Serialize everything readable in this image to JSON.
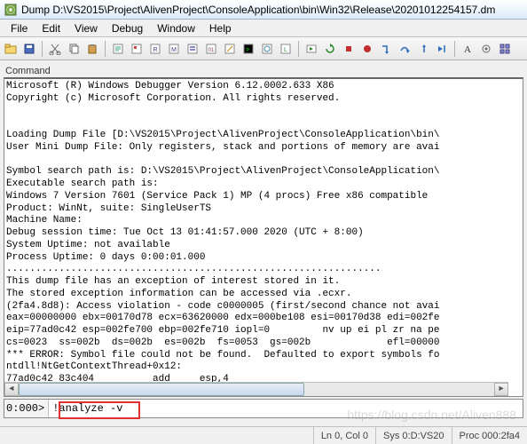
{
  "title_bar": {
    "text": "Dump D:\\VS2015\\Project\\AlivenProject\\ConsoleApplication\\bin\\Win32\\Release\\20201012254157.dm"
  },
  "menu": {
    "items": [
      "File",
      "Edit",
      "View",
      "Debug",
      "Window",
      "Help"
    ]
  },
  "toolbar_icons": [
    "open-file-icon",
    "save-icon",
    "cut-icon",
    "copy-icon",
    "paste-icon",
    "source-icon",
    "properties-icon",
    "registers-icon",
    "memory-icon",
    "callstack-icon",
    "disasm-icon",
    "scratch-icon",
    "command-icon",
    "watch-icon",
    "locals-icon",
    "go-icon",
    "restart-icon",
    "stop-icon",
    "break-icon",
    "step-into-icon",
    "step-over-icon",
    "step-out-icon",
    "run-to-icon",
    "font-icon",
    "options-icon",
    "arrange-icon"
  ],
  "command": {
    "label": "Command",
    "output_lines": [
      "Microsoft (R) Windows Debugger Version 6.12.0002.633 X86",
      "Copyright (c) Microsoft Corporation. All rights reserved.",
      "",
      "",
      "Loading Dump File [D:\\VS2015\\Project\\AlivenProject\\ConsoleApplication\\bin\\",
      "User Mini Dump File: Only registers, stack and portions of memory are avai",
      "",
      "Symbol search path is: D:\\VS2015\\Project\\AlivenProject\\ConsoleApplication\\",
      "Executable search path is:",
      "Windows 7 Version 7601 (Service Pack 1) MP (4 procs) Free x86 compatible",
      "Product: WinNt, suite: SingleUserTS",
      "Machine Name:",
      "Debug session time: Tue Oct 13 01:41:57.000 2020 (UTC + 8:00)",
      "System Uptime: not available",
      "Process Uptime: 0 days 0:00:01.000",
      "................................................................",
      "This dump file has an exception of interest stored in it.",
      "The stored exception information can be accessed via .ecxr.",
      "(2fa4.8d8): Access violation - code c0000005 (first/second chance not avai",
      "eax=00000000 ebx=00170d78 ecx=63620000 edx=000be108 esi=00170d38 edi=002fe",
      "eip=77ad0c42 esp=002fe700 ebp=002fe710 iopl=0         nv up ei pl zr na pe",
      "cs=0023  ss=002b  ds=002b  es=002b  fs=0053  gs=002b             efl=00000",
      "*** ERROR: Symbol file could not be found.  Defaulted to export symbols fo",
      "ntdll!NtGetContextThread+0x12:",
      "77ad0c42 83c404          add     esp,4"
    ]
  },
  "prompt": {
    "prefix": "0:000>",
    "value": "!analyze -v"
  },
  "status": {
    "cells": [
      "Ln 0, Col 0",
      "Sys 0:D:VS20",
      "Proc 000:2fa4"
    ]
  },
  "watermark": "https://blog.csdn.net/Aliven888"
}
